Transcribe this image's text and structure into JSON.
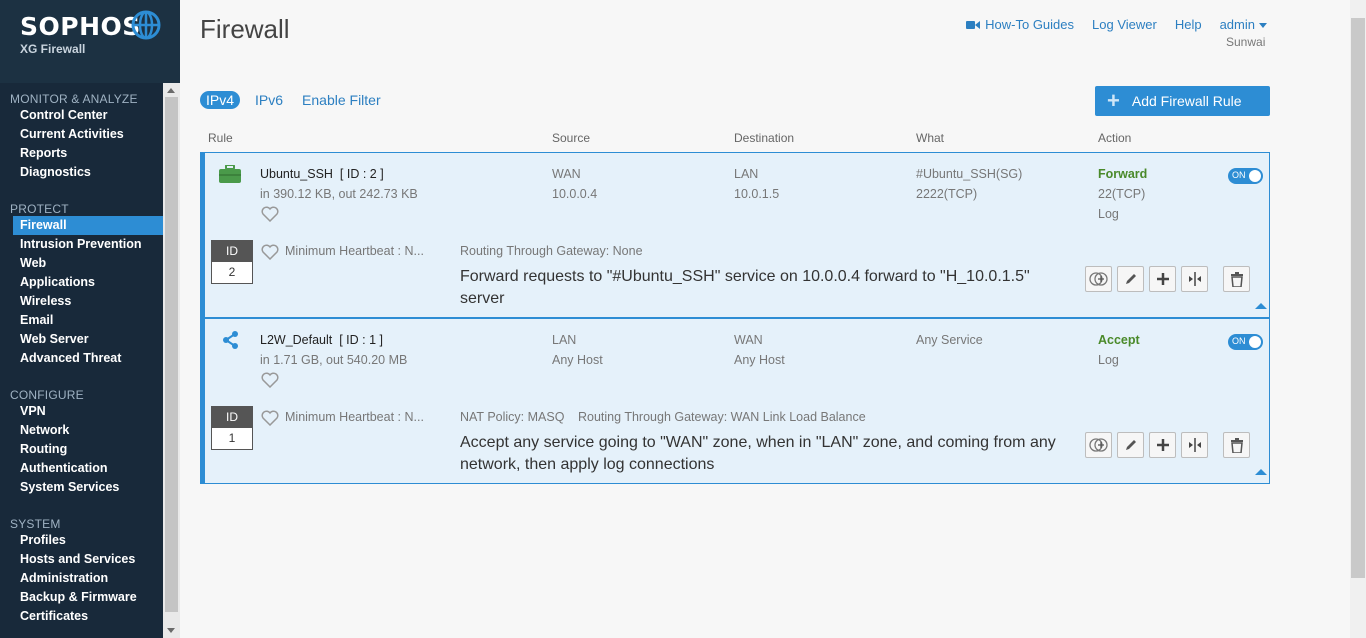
{
  "brand": {
    "name": "SOPHOS",
    "product": "XG Firewall"
  },
  "sidebar": {
    "sections": [
      {
        "title": "MONITOR & ANALYZE",
        "items": [
          "Control Center",
          "Current Activities",
          "Reports",
          "Diagnostics"
        ]
      },
      {
        "title": "PROTECT",
        "items": [
          "Firewall",
          "Intrusion Prevention",
          "Web",
          "Applications",
          "Wireless",
          "Email",
          "Web Server",
          "Advanced Threat"
        ]
      },
      {
        "title": "CONFIGURE",
        "items": [
          "VPN",
          "Network",
          "Routing",
          "Authentication",
          "System Services"
        ]
      },
      {
        "title": "SYSTEM",
        "items": [
          "Profiles",
          "Hosts and Services",
          "Administration",
          "Backup & Firmware",
          "Certificates"
        ]
      }
    ],
    "active": "Firewall"
  },
  "header": {
    "title": "Firewall",
    "links": {
      "howto": "How-To Guides",
      "log_viewer": "Log Viewer",
      "help": "Help",
      "user": "admin"
    },
    "user_sub": "Sunwai"
  },
  "tabs": {
    "ipv4": "IPv4",
    "ipv6": "IPv6",
    "filter": "Enable Filter"
  },
  "add_rule_label": "Add Firewall Rule",
  "columns": {
    "rule": "Rule",
    "source": "Source",
    "destination": "Destination",
    "what": "What",
    "action": "Action"
  },
  "rules": [
    {
      "name": "Ubuntu_SSH",
      "id_tag": "[ ID : 2 ]",
      "traffic": "in 390.12 KB, out 242.73 KB",
      "source_zone": "WAN",
      "source_net": "10.0.0.4",
      "dest_zone": "LAN",
      "dest_net": "10.0.1.5",
      "what_1": "#Ubuntu_SSH(SG)",
      "what_2": "2222(TCP)",
      "action": "Forward",
      "action_2": "22(TCP)",
      "action_3": "Log",
      "toggle": "ON",
      "id_label": "ID",
      "id_num": "2",
      "heartbeat": "Minimum Heartbeat : N...",
      "info_1": "Routing Through Gateway: None",
      "info_2": "",
      "desc": "Forward requests to \"#Ubuntu_SSH\" service on 10.0.0.4 forward to \"H_10.0.1.5\" server"
    },
    {
      "name": "L2W_Default",
      "id_tag": "[ ID : 1 ]",
      "traffic": "in 1.71 GB, out 540.20 MB",
      "source_zone": "LAN",
      "source_net": "Any Host",
      "dest_zone": "WAN",
      "dest_net": "Any Host",
      "what_1": "Any Service",
      "what_2": "",
      "action": "Accept",
      "action_2": "Log",
      "action_3": "",
      "toggle": "ON",
      "id_label": "ID",
      "id_num": "1",
      "heartbeat": "Minimum Heartbeat : N...",
      "info_1": "NAT Policy: MASQ",
      "info_2": "Routing Through Gateway: WAN Link Load Balance",
      "desc": "Accept any service going to \"WAN\" zone, when in \"LAN\" zone, and coming from any network, then apply log connections"
    }
  ],
  "colors": {
    "accent": "#2d8dd4",
    "sidebar": "#18293a",
    "action_green": "#4a8a2a",
    "row_bg": "#e5f1fa"
  }
}
